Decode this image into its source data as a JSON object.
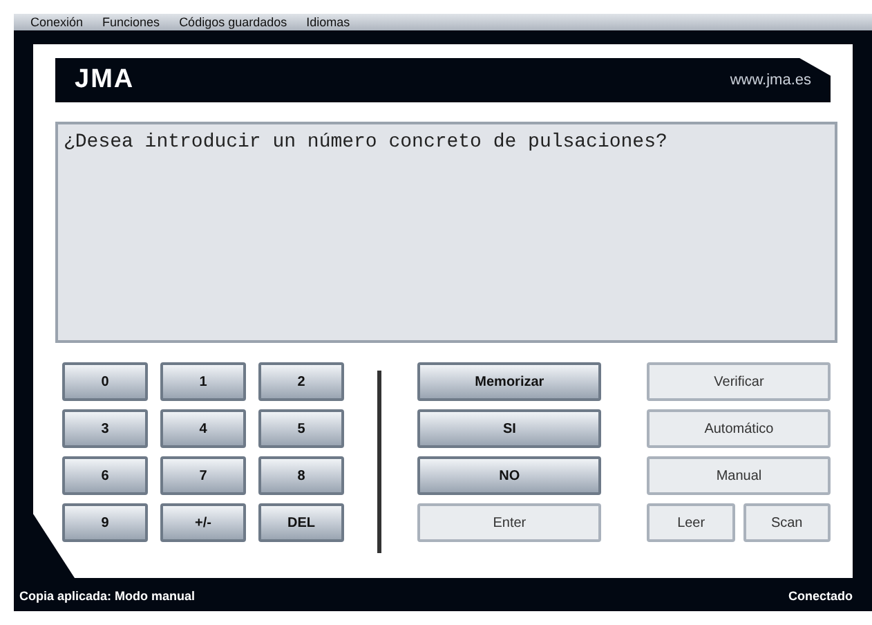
{
  "menu": [
    "Conexión",
    "Funciones",
    "Códigos guardados",
    "Idiomas"
  ],
  "header": {
    "logo": "JMA",
    "url": "www.jma.es"
  },
  "display": "¿Desea introducir un número concreto de pulsaciones?",
  "keypad": [
    "0",
    "1",
    "2",
    "3",
    "4",
    "5",
    "6",
    "7",
    "8",
    "9",
    "+/-",
    "DEL"
  ],
  "actions": [
    {
      "label": "Memorizar",
      "kind": "dark"
    },
    {
      "label": "SI",
      "kind": "dark"
    },
    {
      "label": "NO",
      "kind": "dark"
    },
    {
      "label": "Enter",
      "kind": "light"
    }
  ],
  "modes": [
    {
      "label": "Verificar",
      "kind": "light"
    },
    {
      "label": "Automático",
      "kind": "light"
    },
    {
      "label": "Manual",
      "kind": "light"
    }
  ],
  "small_buttons": [
    "Leer",
    "Scan"
  ],
  "status": {
    "left": "Copia aplicada: Modo manual",
    "right": "Conectado"
  }
}
